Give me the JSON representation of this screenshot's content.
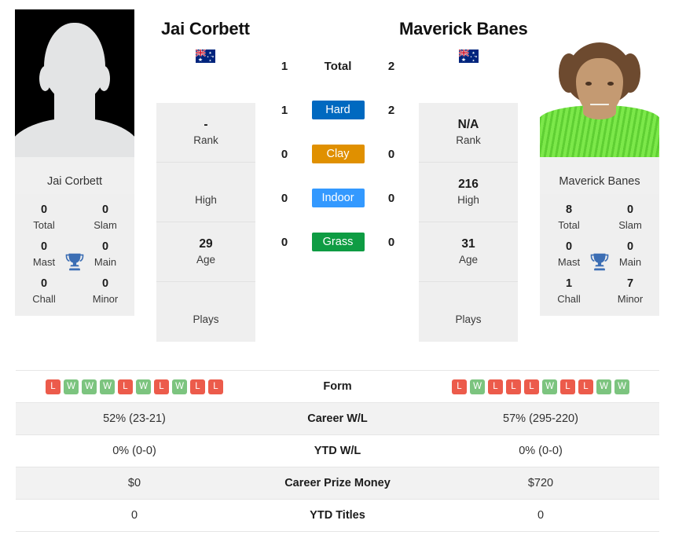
{
  "players": {
    "left": {
      "name": "Jai Corbett",
      "photo_caption": "Jai Corbett",
      "flag": "australia-flag",
      "avatar_type": "silhouette-avatar",
      "titles": [
        {
          "value": "0",
          "label": "Total"
        },
        {
          "value": "0",
          "label": "Slam"
        },
        {
          "value": "0",
          "label": "Mast"
        },
        {
          "value": "0",
          "label": "Main"
        },
        {
          "value": "0",
          "label": "Chall"
        },
        {
          "value": "0",
          "label": "Minor"
        }
      ],
      "info": [
        {
          "value": "-",
          "label": "Rank"
        },
        {
          "value": "",
          "label": "High"
        },
        {
          "value": "29",
          "label": "Age"
        },
        {
          "value": "",
          "label": "Plays"
        }
      ],
      "form": [
        "L",
        "W",
        "W",
        "W",
        "L",
        "W",
        "L",
        "W",
        "L",
        "L"
      ],
      "career_wl": "52% (23-21)",
      "ytd_wl": "0% (0-0)",
      "career_prize_money": "$0",
      "ytd_titles": "0"
    },
    "right": {
      "name": "Maverick Banes",
      "photo_caption": "Maverick Banes",
      "flag": "australia-flag",
      "avatar_type": "player-photo",
      "titles": [
        {
          "value": "8",
          "label": "Total"
        },
        {
          "value": "0",
          "label": "Slam"
        },
        {
          "value": "0",
          "label": "Mast"
        },
        {
          "value": "0",
          "label": "Main"
        },
        {
          "value": "1",
          "label": "Chall"
        },
        {
          "value": "7",
          "label": "Minor"
        }
      ],
      "info": [
        {
          "value": "N/A",
          "label": "Rank"
        },
        {
          "value": "216",
          "label": "High"
        },
        {
          "value": "31",
          "label": "Age"
        },
        {
          "value": "",
          "label": "Plays"
        }
      ],
      "form": [
        "L",
        "W",
        "L",
        "L",
        "L",
        "W",
        "L",
        "L",
        "W",
        "W"
      ],
      "career_wl": "57% (295-220)",
      "ytd_wl": "0% (0-0)",
      "career_prize_money": "$720",
      "ytd_titles": "0"
    }
  },
  "head_to_head": [
    {
      "label": "Total",
      "left": "1",
      "right": "2",
      "badge": false,
      "color": ""
    },
    {
      "label": "Hard",
      "left": "1",
      "right": "2",
      "badge": true,
      "color": "#0069c0"
    },
    {
      "label": "Clay",
      "left": "0",
      "right": "0",
      "badge": true,
      "color": "#e09000"
    },
    {
      "label": "Indoor",
      "left": "0",
      "right": "0",
      "badge": true,
      "color": "#3399ff"
    },
    {
      "label": "Grass",
      "left": "0",
      "right": "0",
      "badge": true,
      "color": "#0e9c43"
    }
  ],
  "comparison_rows": [
    {
      "label": "Form",
      "type": "form"
    },
    {
      "label": "Career W/L",
      "type": "text",
      "key": "career_wl"
    },
    {
      "label": "YTD W/L",
      "type": "text",
      "key": "ytd_wl"
    },
    {
      "label": "Career Prize Money",
      "type": "text",
      "key": "career_prize_money"
    },
    {
      "label": "YTD Titles",
      "type": "text",
      "key": "ytd_titles"
    }
  ],
  "colors": {
    "hard": "#0069c0",
    "clay": "#e09000",
    "indoor": "#3399ff",
    "grass": "#0e9c43",
    "win": "#7cc47f",
    "loss": "#ec5b4b",
    "trophy": "#3c6eb4"
  }
}
